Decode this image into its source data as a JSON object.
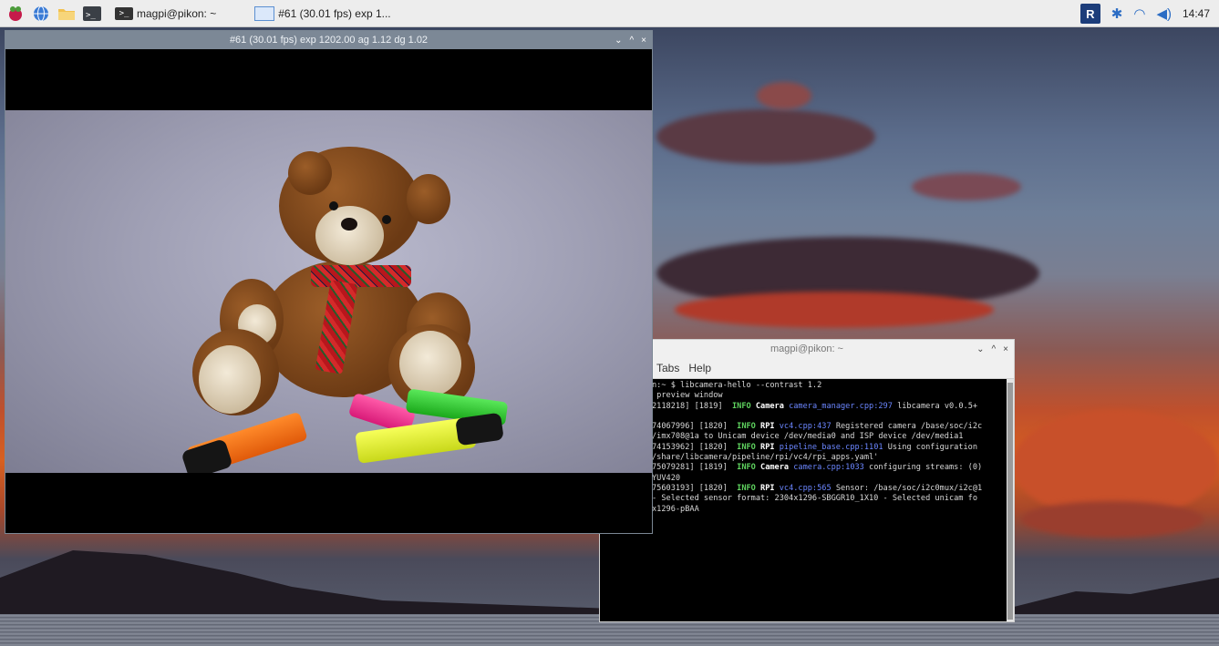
{
  "taskbar": {
    "launchers": [
      {
        "name": "raspberry-menu",
        "icon": "raspberry-icon"
      },
      {
        "name": "web-browser",
        "icon": "globe-icon"
      },
      {
        "name": "file-manager",
        "icon": "folder-icon"
      },
      {
        "name": "terminal",
        "icon": "terminal-icon"
      }
    ],
    "tasks": [
      {
        "label": "magpi@pikon: ~",
        "icon": "terminal-icon"
      },
      {
        "label": "#61 (30.01 fps) exp 1...",
        "icon": "window-icon"
      }
    ],
    "tray": {
      "vnc_label": "R",
      "clock": "14:47"
    }
  },
  "camera_window": {
    "title": "#61 (30.01 fps) exp 1202.00 ag 1.12 dg 1.02",
    "controls": [
      "⌄",
      "^",
      "×"
    ]
  },
  "terminal_window": {
    "title": "magpi@pikon: ~",
    "controls": [
      "⌄",
      "^",
      "×"
    ],
    "menu": [
      "Tabs",
      "Help"
    ],
    "lines": {
      "l1": "n:~ $ libcamera-hello --contrast 1.2",
      "l2": " preview window",
      "l3a": "2118218] [1819]  ",
      "l3b": "INFO",
      "l3c": " Camera ",
      "l3d": "camera_manager.cpp:297",
      "l3e": " libcamera v0.0.5+",
      "l4a": "74067996] [1820]  ",
      "l4b": "INFO",
      "l4c": " RPI ",
      "l4d": "vc4.cpp:437",
      "l4e": " Registered camera /base/soc/i2c",
      "l5": "/imx708@1a to Unicam device /dev/media0 and ISP device /dev/media1",
      "l6a": "74153962] [1820]  ",
      "l6b": "INFO",
      "l6c": " RPI ",
      "l6d": "pipeline_base.cpp:1101",
      "l6e": " Using configuration",
      "l7": "/share/libcamera/pipeline/rpi/vc4/rpi_apps.yaml'",
      "l8a": "75079281] [1819]  ",
      "l8b": "INFO",
      "l8c": " Camera ",
      "l8d": "camera.cpp:1033",
      "l8e": " configuring streams: (0)",
      "l9": "YUV420",
      "l10a": "75603193] [1820]  ",
      "l10b": "INFO",
      "l10c": " RPI ",
      "l10d": "vc4.cpp:565",
      "l10e": " Sensor: /base/soc/i2c0mux/i2c@1",
      "l11": "- Selected sensor format: 2304x1296-SBGGR10_1X10 - Selected unicam fo",
      "l12": "x1296-pBAA"
    }
  }
}
